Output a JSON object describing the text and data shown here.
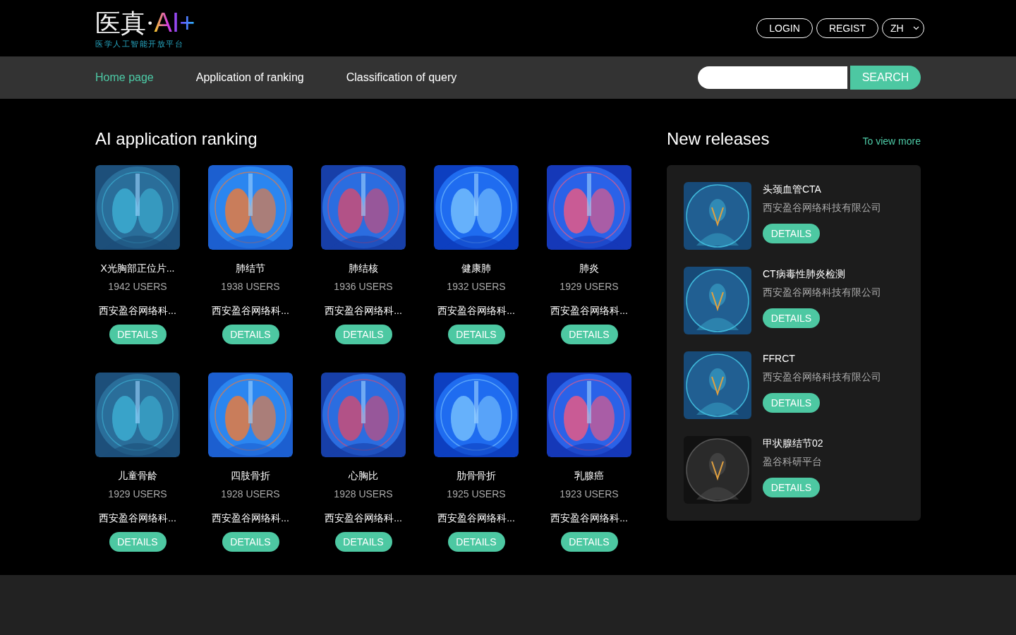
{
  "logo": {
    "title": "医真·",
    "accent": "AI+",
    "subtitle": "医学人工智能开放平台"
  },
  "header_buttons": [
    "LOGIN",
    "REGIST"
  ],
  "language": {
    "value": "ZH"
  },
  "nav": [
    {
      "label": "Home page",
      "selected": true
    },
    {
      "label": "Application of ranking",
      "selected": false
    },
    {
      "label": "Classification of query",
      "selected": false
    }
  ],
  "search": {
    "button": "SEARCH"
  },
  "ranking": {
    "title": "AI application ranking",
    "apps": [
      {
        "name": "X光胸部正位片...",
        "users": "1942 USERS",
        "company": "西安盈谷网络科...",
        "button": "DETAILS"
      },
      {
        "name": "肺结节",
        "users": "1938 USERS",
        "company": "西安盈谷网络科...",
        "button": "DETAILS"
      },
      {
        "name": "肺结核",
        "users": "1936 USERS",
        "company": "西安盈谷网络科...",
        "button": "DETAILS"
      },
      {
        "name": "健康肺",
        "users": "1932 USERS",
        "company": "西安盈谷网络科...",
        "button": "DETAILS"
      },
      {
        "name": "肺炎",
        "users": "1929 USERS",
        "company": "西安盈谷网络科...",
        "button": "DETAILS"
      },
      {
        "name": "儿童骨龄",
        "users": "1929 USERS",
        "company": "西安盈谷网络科...",
        "button": "DETAILS"
      },
      {
        "name": "四肢骨折",
        "users": "1928 USERS",
        "company": "西安盈谷网络科...",
        "button": "DETAILS"
      },
      {
        "name": "心胸比",
        "users": "1928 USERS",
        "company": "西安盈谷网络科...",
        "button": "DETAILS"
      },
      {
        "name": "肋骨骨折",
        "users": "1925 USERS",
        "company": "西安盈谷网络科...",
        "button": "DETAILS"
      },
      {
        "name": "乳腺癌",
        "users": "1923 USERS",
        "company": "西安盈谷网络科...",
        "button": "DETAILS"
      }
    ]
  },
  "releases": {
    "title": "New releases",
    "more": "To view more",
    "items": [
      {
        "name": "头颈血管CTA",
        "company": "西安盈谷网络科技有限公司",
        "button": "DETAILS"
      },
      {
        "name": "CT病毒性肺炎检测",
        "company": "西安盈谷网络科技有限公司",
        "button": "DETAILS"
      },
      {
        "name": "FFRCT",
        "company": "西安盈谷网络科技有限公司",
        "button": "DETAILS"
      },
      {
        "name": "甲状腺结节02",
        "company": "盈谷科研平台",
        "button": "DETAILS"
      }
    ]
  }
}
